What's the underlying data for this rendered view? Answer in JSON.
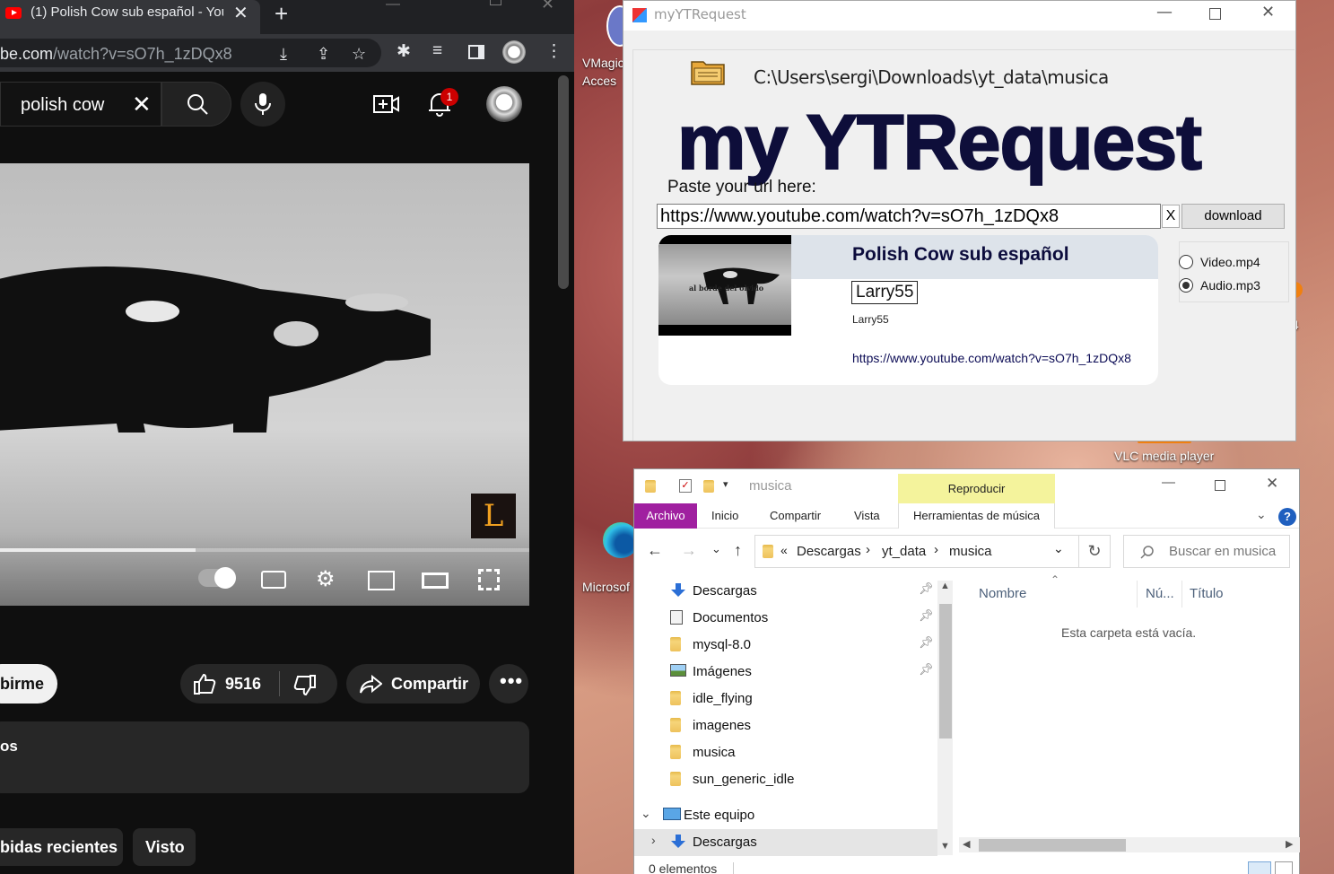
{
  "chrome": {
    "tab_title": "(1) Polish Cow sub español - You",
    "url_host": "be.com",
    "url_path": "/watch?v=sO7h_1zDQx8"
  },
  "youtube": {
    "search_query": "polish cow",
    "notification_count": "1",
    "subscribe_label": "birme",
    "like_count": "9516",
    "share_label": "Compartir",
    "description_snippet": "os",
    "chips": [
      "bidas recientes",
      "Visto"
    ],
    "playback_progress": 0.37
  },
  "desktop": {
    "icons": [
      "VMagic",
      "Acces",
      "Microsof",
      "VLC media player",
      ".4"
    ]
  },
  "ytrequest": {
    "window_title": "myYTRequest",
    "save_path": "C:\\Users\\sergi\\Downloads\\yt_data\\musica",
    "logo_text": "my YTRequest",
    "paste_label": "Paste your url here:",
    "url_value": "https://www.youtube.com/watch?v=sO7h_1zDQx8",
    "clear_label": "X",
    "download_label": "download",
    "video_title": "Polish Cow sub español",
    "channel_name": "Larry55",
    "channel_small": "Larry55",
    "video_link": "https://www.youtube.com/watch?v=sO7h_1zDQx8",
    "thumb_caption": "al borde del olvido",
    "formats": [
      {
        "label": "Video.mp4",
        "selected": false
      },
      {
        "label": "Audio.mp3",
        "selected": true
      }
    ]
  },
  "explorer": {
    "window_title": "musica",
    "context_tab": "Reproducir",
    "ribbon_tabs": [
      "Archivo",
      "Inicio",
      "Compartir",
      "Vista",
      "Herramientas de música"
    ],
    "breadcrumb": [
      "Descargas",
      "yt_data",
      "musica"
    ],
    "search_placeholder": "Buscar en musica",
    "tree": [
      {
        "label": "Descargas",
        "icon": "download-arrow-icon",
        "pinned": true
      },
      {
        "label": "Documentos",
        "icon": "document-icon",
        "pinned": true
      },
      {
        "label": "mysql-8.0",
        "icon": "folder-icon",
        "pinned": true
      },
      {
        "label": "Imágenes",
        "icon": "pictures-icon",
        "pinned": true
      },
      {
        "label": "idle_flying",
        "icon": "folder-icon",
        "pinned": false
      },
      {
        "label": "imagenes",
        "icon": "folder-icon",
        "pinned": false
      },
      {
        "label": "musica",
        "icon": "folder-icon",
        "pinned": false
      },
      {
        "label": "sun_generic_idle",
        "icon": "folder-icon",
        "pinned": false
      },
      {
        "label": "Este equipo",
        "icon": "computer-icon",
        "pinned": false
      },
      {
        "label": "Descargas",
        "icon": "download-arrow-icon",
        "pinned": false
      }
    ],
    "columns": [
      "Nombre",
      "Nú...",
      "Título"
    ],
    "empty_message": "Esta carpeta está vacía.",
    "status": "0 elementos"
  }
}
